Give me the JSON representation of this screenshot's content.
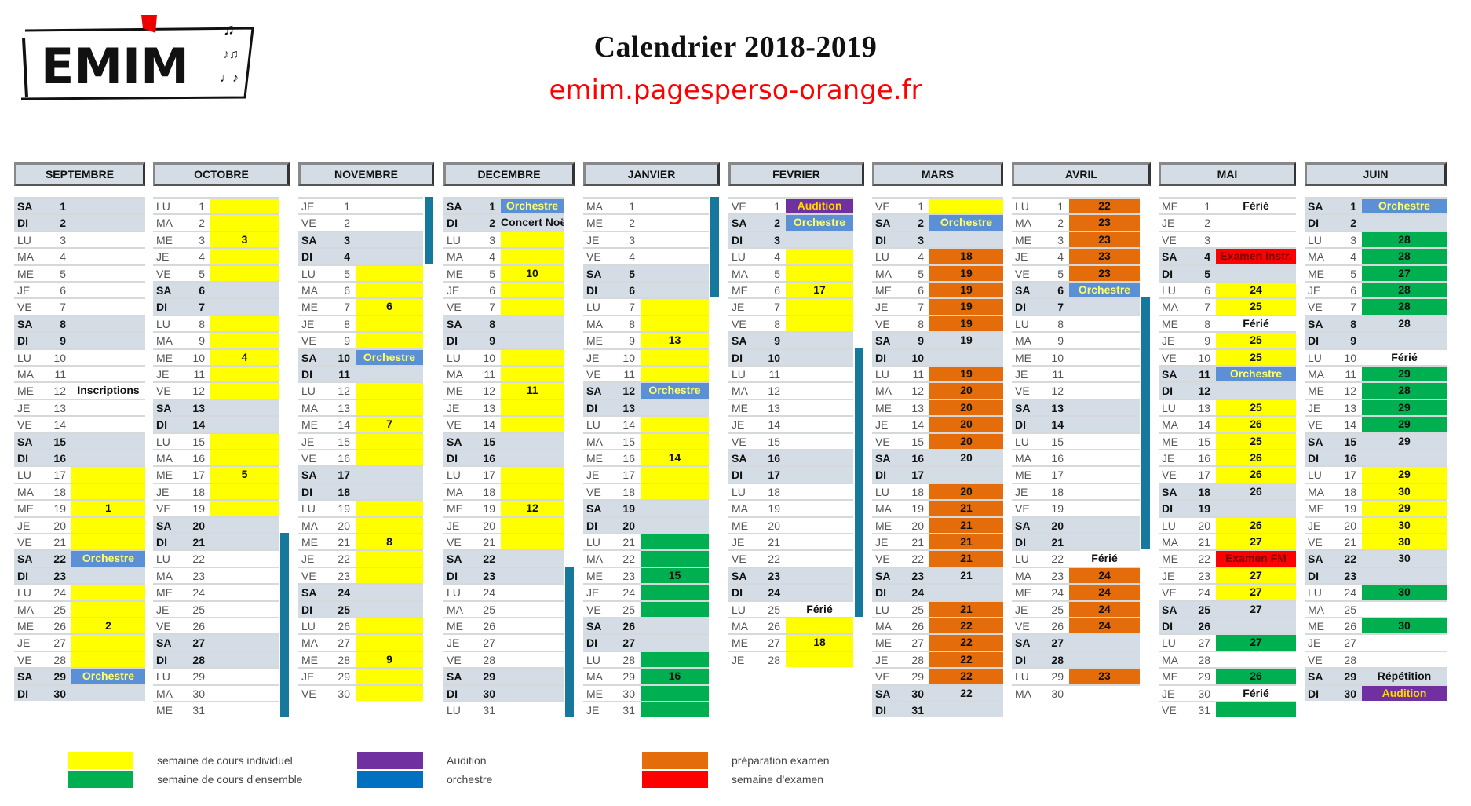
{
  "header": {
    "logo_text": "EMIM",
    "title": "Calendrier 2018-2019",
    "url": "emim.pagesperso-orange.fr"
  },
  "colors": {
    "yellow": "#ffff00",
    "green": "#00b050",
    "purple": "#7030a0",
    "blue": "#0070c0",
    "orange": "#e46c0a",
    "red": "#ff0000",
    "weekend": "#d4dde5",
    "vacation_bar": "#17789e"
  },
  "months": [
    {
      "name": "SEPTEMBRE",
      "start": "SA",
      "days": 30,
      "events": {
        "12": {
          "t": "Inscriptions",
          "c": "none"
        },
        "17": {
          "c": "yellow"
        },
        "18": {
          "c": "yellow"
        },
        "19": {
          "t": "1",
          "c": "yellow"
        },
        "20": {
          "c": "yellow"
        },
        "21": {
          "c": "yellow"
        },
        "22": {
          "t": "Orchestre",
          "c": "blue"
        },
        "24": {
          "c": "yellow"
        },
        "25": {
          "c": "yellow"
        },
        "26": {
          "t": "2",
          "c": "yellow"
        },
        "27": {
          "c": "yellow"
        },
        "28": {
          "c": "yellow"
        },
        "29": {
          "t": "Orchestre",
          "c": "blue"
        }
      }
    },
    {
      "name": "OCTOBRE",
      "start": "LU",
      "days": 31,
      "events": {
        "1": {
          "c": "yellow"
        },
        "2": {
          "c": "yellow"
        },
        "3": {
          "t": "3",
          "c": "yellow"
        },
        "4": {
          "c": "yellow"
        },
        "5": {
          "c": "yellow"
        },
        "8": {
          "c": "yellow"
        },
        "9": {
          "c": "yellow"
        },
        "10": {
          "t": "4",
          "c": "yellow"
        },
        "11": {
          "c": "yellow"
        },
        "12": {
          "c": "yellow"
        },
        "15": {
          "c": "yellow"
        },
        "16": {
          "c": "yellow"
        },
        "17": {
          "t": "5",
          "c": "yellow"
        },
        "18": {
          "c": "yellow"
        },
        "19": {
          "c": "yellow"
        }
      },
      "vacation": [
        21,
        31
      ]
    },
    {
      "name": "NOVEMBRE",
      "start": "JE",
      "days": 30,
      "events": {
        "5": {
          "c": "yellow"
        },
        "6": {
          "c": "yellow"
        },
        "7": {
          "t": "6",
          "c": "yellow"
        },
        "8": {
          "c": "yellow"
        },
        "9": {
          "c": "yellow"
        },
        "10": {
          "t": "Orchestre",
          "c": "blue"
        },
        "12": {
          "c": "yellow"
        },
        "13": {
          "c": "yellow"
        },
        "14": {
          "t": "7",
          "c": "yellow"
        },
        "15": {
          "c": "yellow"
        },
        "16": {
          "c": "yellow"
        },
        "19": {
          "c": "yellow"
        },
        "20": {
          "c": "yellow"
        },
        "21": {
          "t": "8",
          "c": "yellow"
        },
        "22": {
          "c": "yellow"
        },
        "23": {
          "c": "yellow"
        },
        "26": {
          "c": "yellow"
        },
        "27": {
          "c": "yellow"
        },
        "28": {
          "t": "9",
          "c": "yellow"
        },
        "29": {
          "c": "yellow"
        },
        "30": {
          "c": "yellow"
        }
      },
      "vacation": [
        1,
        4
      ]
    },
    {
      "name": "DECEMBRE",
      "start": "SA",
      "days": 31,
      "events": {
        "1": {
          "t": "Orchestre",
          "c": "blue"
        },
        "2": {
          "t": "Concert Noël",
          "c": "none"
        },
        "3": {
          "c": "yellow"
        },
        "4": {
          "c": "yellow"
        },
        "5": {
          "t": "10",
          "c": "yellow"
        },
        "6": {
          "c": "yellow"
        },
        "7": {
          "c": "yellow"
        },
        "10": {
          "c": "yellow"
        },
        "11": {
          "c": "yellow"
        },
        "12": {
          "t": "11",
          "c": "yellow"
        },
        "13": {
          "c": "yellow"
        },
        "14": {
          "c": "yellow"
        },
        "17": {
          "c": "yellow"
        },
        "18": {
          "c": "yellow"
        },
        "19": {
          "t": "12",
          "c": "yellow"
        },
        "20": {
          "c": "yellow"
        },
        "21": {
          "c": "yellow"
        }
      },
      "vacation": [
        23,
        31
      ]
    },
    {
      "name": "JANVIER",
      "start": "MA",
      "days": 31,
      "events": {
        "7": {
          "c": "yellow"
        },
        "8": {
          "c": "yellow"
        },
        "9": {
          "t": "13",
          "c": "yellow"
        },
        "10": {
          "c": "yellow"
        },
        "11": {
          "c": "yellow"
        },
        "12": {
          "t": "Orchestre",
          "c": "blue"
        },
        "14": {
          "c": "yellow"
        },
        "15": {
          "c": "yellow"
        },
        "16": {
          "t": "14",
          "c": "yellow"
        },
        "17": {
          "c": "yellow"
        },
        "18": {
          "c": "yellow"
        },
        "21": {
          "c": "green"
        },
        "22": {
          "c": "green"
        },
        "23": {
          "t": "15",
          "c": "green"
        },
        "24": {
          "c": "green"
        },
        "25": {
          "c": "green"
        },
        "28": {
          "c": "green"
        },
        "29": {
          "t": "16",
          "c": "green"
        },
        "30": {
          "c": "green"
        },
        "31": {
          "c": "green"
        }
      },
      "vacation": [
        1,
        6
      ]
    },
    {
      "name": "FEVRIER",
      "start": "VE",
      "days": 28,
      "events": {
        "1": {
          "t": "Audition",
          "c": "purple"
        },
        "2": {
          "t": "Orchestre",
          "c": "blue"
        },
        "4": {
          "c": "yellow"
        },
        "5": {
          "c": "yellow"
        },
        "6": {
          "t": "17",
          "c": "yellow"
        },
        "7": {
          "c": "yellow"
        },
        "8": {
          "c": "yellow"
        },
        "25": {
          "t": "Férié",
          "c": "none"
        },
        "26": {
          "c": "yellow"
        },
        "27": {
          "t": "18",
          "c": "yellow"
        },
        "28": {
          "c": "yellow"
        }
      },
      "vacation": [
        10,
        25
      ]
    },
    {
      "name": "MARS",
      "start": "VE",
      "days": 31,
      "events": {
        "1": {
          "c": "yellow"
        },
        "2": {
          "t": "Orchestre",
          "c": "blue"
        },
        "4": {
          "t": "18",
          "c": "orange"
        },
        "5": {
          "t": "19",
          "c": "orange"
        },
        "6": {
          "t": "19",
          "c": "orange"
        },
        "7": {
          "t": "19",
          "c": "orange"
        },
        "8": {
          "t": "19",
          "c": "orange"
        },
        "9": {
          "t": "19",
          "c": "none"
        },
        "11": {
          "t": "19",
          "c": "orange"
        },
        "12": {
          "t": "20",
          "c": "orange"
        },
        "13": {
          "t": "20",
          "c": "orange"
        },
        "14": {
          "t": "20",
          "c": "orange"
        },
        "15": {
          "t": "20",
          "c": "orange"
        },
        "16": {
          "t": "20",
          "c": "none"
        },
        "18": {
          "t": "20",
          "c": "orange"
        },
        "19": {
          "t": "21",
          "c": "orange"
        },
        "20": {
          "t": "21",
          "c": "orange"
        },
        "21": {
          "t": "21",
          "c": "orange"
        },
        "22": {
          "t": "21",
          "c": "orange"
        },
        "23": {
          "t": "21",
          "c": "none"
        },
        "25": {
          "t": "21",
          "c": "orange"
        },
        "26": {
          "t": "22",
          "c": "orange"
        },
        "27": {
          "t": "22",
          "c": "orange"
        },
        "28": {
          "t": "22",
          "c": "orange"
        },
        "29": {
          "t": "22",
          "c": "orange"
        },
        "30": {
          "t": "22",
          "c": "none"
        }
      }
    },
    {
      "name": "AVRIL",
      "start": "LU",
      "days": 30,
      "events": {
        "1": {
          "t": "22",
          "c": "orange"
        },
        "2": {
          "t": "23",
          "c": "orange"
        },
        "3": {
          "t": "23",
          "c": "orange"
        },
        "4": {
          "t": "23",
          "c": "orange"
        },
        "5": {
          "t": "23",
          "c": "orange"
        },
        "6": {
          "t": "Orchestre",
          "c": "blue"
        },
        "22": {
          "t": "Férié",
          "c": "none"
        },
        "23": {
          "t": "24",
          "c": "orange"
        },
        "24": {
          "t": "24",
          "c": "orange"
        },
        "25": {
          "t": "24",
          "c": "orange"
        },
        "26": {
          "t": "24",
          "c": "orange"
        },
        "29": {
          "t": "23",
          "c": "orange"
        }
      },
      "vacation": [
        7,
        21
      ]
    },
    {
      "name": "MAI",
      "start": "ME",
      "days": 31,
      "events": {
        "1": {
          "t": "Férié",
          "c": "none"
        },
        "4": {
          "t": "Examen instr.",
          "c": "red"
        },
        "6": {
          "t": "24",
          "c": "yellow"
        },
        "7": {
          "t": "25",
          "c": "yellow"
        },
        "8": {
          "t": "Férié",
          "c": "none"
        },
        "9": {
          "t": "25",
          "c": "yellow"
        },
        "10": {
          "t": "25",
          "c": "yellow"
        },
        "11": {
          "t": "Orchestre",
          "c": "blue"
        },
        "13": {
          "t": "25",
          "c": "yellow"
        },
        "14": {
          "t": "26",
          "c": "yellow"
        },
        "15": {
          "t": "25",
          "c": "yellow"
        },
        "16": {
          "t": "26",
          "c": "yellow"
        },
        "17": {
          "t": "26",
          "c": "yellow"
        },
        "18": {
          "t": "26",
          "c": "none"
        },
        "20": {
          "t": "26",
          "c": "yellow"
        },
        "21": {
          "t": "27",
          "c": "yellow"
        },
        "22": {
          "t": "Examen FM",
          "c": "red"
        },
        "23": {
          "t": "27",
          "c": "yellow"
        },
        "24": {
          "t": "27",
          "c": "yellow"
        },
        "25": {
          "t": "27",
          "c": "none"
        },
        "27": {
          "t": "27",
          "c": "green"
        },
        "29": {
          "t": "26",
          "c": "green"
        },
        "30": {
          "t": "Férié",
          "c": "none"
        },
        "31": {
          "c": "green"
        }
      }
    },
    {
      "name": "JUIN",
      "start": "SA",
      "days": 30,
      "events": {
        "1": {
          "t": "Orchestre",
          "c": "blue"
        },
        "3": {
          "t": "28",
          "c": "green"
        },
        "4": {
          "t": "28",
          "c": "green"
        },
        "5": {
          "t": "27",
          "c": "green"
        },
        "6": {
          "t": "28",
          "c": "green"
        },
        "7": {
          "t": "28",
          "c": "green"
        },
        "8": {
          "t": "28",
          "c": "none"
        },
        "10": {
          "t": "Férié",
          "c": "none"
        },
        "11": {
          "t": "29",
          "c": "green"
        },
        "12": {
          "t": "28",
          "c": "green"
        },
        "13": {
          "t": "29",
          "c": "green"
        },
        "14": {
          "t": "29",
          "c": "green"
        },
        "15": {
          "t": "29",
          "c": "none"
        },
        "17": {
          "t": "29",
          "c": "yellow"
        },
        "18": {
          "t": "30",
          "c": "yellow"
        },
        "19": {
          "t": "29",
          "c": "yellow"
        },
        "20": {
          "t": "30",
          "c": "yellow"
        },
        "21": {
          "t": "30",
          "c": "yellow"
        },
        "22": {
          "t": "30",
          "c": "none"
        },
        "24": {
          "t": "30",
          "c": "green"
        },
        "26": {
          "t": "30",
          "c": "green"
        },
        "29": {
          "t": "Répétition",
          "c": "none"
        },
        "30": {
          "t": "Audition",
          "c": "purple"
        }
      }
    }
  ],
  "weekdays": [
    "LU",
    "MA",
    "ME",
    "JE",
    "VE",
    "SA",
    "DI"
  ],
  "legend": [
    {
      "label": "semaine de cours individuel",
      "color": "#ffff00"
    },
    {
      "label": "semaine de cours d'ensemble",
      "color": "#00b050"
    },
    {
      "label": "Audition",
      "color": "#7030a0"
    },
    {
      "label": "orchestre",
      "color": "#0070c0"
    },
    {
      "label": "préparation examen",
      "color": "#e46c0a"
    },
    {
      "label": "semaine d'examen",
      "color": "#ff0000"
    }
  ]
}
